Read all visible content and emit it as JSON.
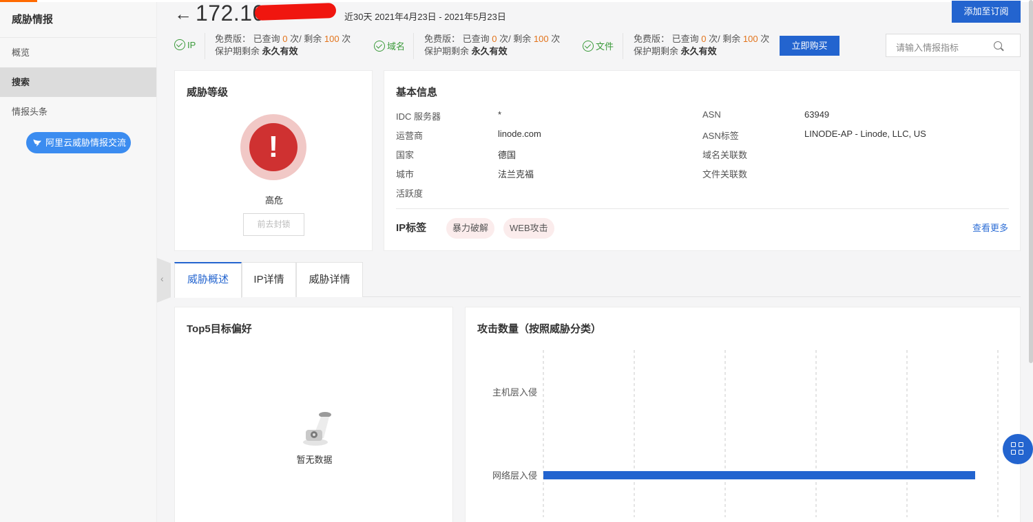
{
  "sidebar": {
    "brand": "威胁情报",
    "items": [
      {
        "label": "概览",
        "active": false
      },
      {
        "label": "搜索",
        "active": true
      },
      {
        "label": "情报头条",
        "active": false
      }
    ],
    "community_button": "阿里云威胁情报交流"
  },
  "header": {
    "ip_prefix": "172.10",
    "date_range": "近30天 2021年4月23日 - 2021年5月23日",
    "subscribe_label": "添加至订阅",
    "buy_label": "立即购买",
    "search_placeholder": "请输入情报指标"
  },
  "quotas": [
    {
      "type": "IP",
      "line1_prefix": "免费版：  已查询 ",
      "queried": "0",
      "line1_mid": " 次/  剩余 ",
      "remaining": "100",
      "line1_suffix": " 次",
      "line2_label": "保护期剩余 ",
      "line2_value": "永久有效"
    },
    {
      "type": "域名",
      "line1_prefix": "免费版：  已查询 ",
      "queried": "0",
      "line1_mid": " 次/  剩余 ",
      "remaining": "100",
      "line1_suffix": " 次",
      "line2_label": "保护期剩余 ",
      "line2_value": "永久有效"
    },
    {
      "type": "文件",
      "line1_prefix": "免费版：  已查询 ",
      "queried": "0",
      "line1_mid": " 次/  剩余 ",
      "remaining": "100",
      "line1_suffix": " 次",
      "line2_label": "保护期剩余 ",
      "line2_value": "永久有效"
    }
  ],
  "threat": {
    "title": "威胁等级",
    "icon_symbol": "!",
    "level": "高危",
    "block_button": "前去封锁",
    "colors": {
      "outer": "#f1c8c6",
      "inner": "#cf3131"
    }
  },
  "basic": {
    "title": "基本信息",
    "left": [
      {
        "label": "IDC 服务器",
        "value": "*"
      },
      {
        "label": "运营商",
        "value": "linode.com"
      },
      {
        "label": "国家",
        "value": "德国"
      },
      {
        "label": "城市",
        "value": "法兰克福"
      },
      {
        "label": "活跃度",
        "value": ""
      }
    ],
    "right": [
      {
        "label": "ASN",
        "value": "63949"
      },
      {
        "label": "ASN标签",
        "value": "LINODE-AP - Linode, LLC, US"
      },
      {
        "label": "域名关联数",
        "value": ""
      },
      {
        "label": "文件关联数",
        "value": ""
      }
    ],
    "tags_title": "IP标签",
    "tags": [
      "暴力破解",
      "WEB攻击"
    ],
    "more_link": "查看更多"
  },
  "tabs": [
    {
      "label": "威胁概述",
      "active": true
    },
    {
      "label": "IP详情",
      "active": false
    },
    {
      "label": "威胁详情",
      "active": false
    }
  ],
  "top5": {
    "title": "Top5目标偏好",
    "empty_text": "暂无数据"
  },
  "attack": {
    "title": "攻击数量（按照威胁分类）"
  },
  "chart_data": {
    "type": "bar",
    "orientation": "horizontal",
    "categories": [
      "主机层入侵",
      "网络层入侵"
    ],
    "values": [
      0,
      1
    ],
    "value_axis_max": 1,
    "grid": true,
    "bar_color": "#2364cf"
  }
}
